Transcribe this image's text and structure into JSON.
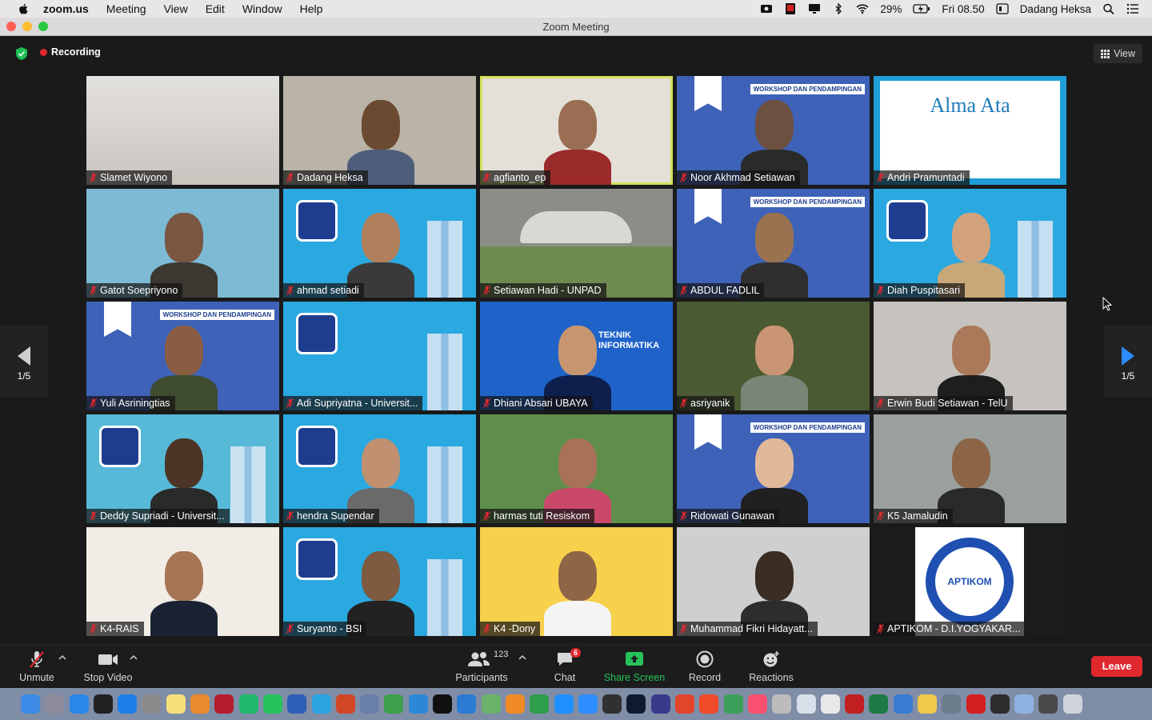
{
  "menubar": {
    "app": "zoom.us",
    "items": [
      "Meeting",
      "View",
      "Edit",
      "Window",
      "Help"
    ],
    "battery": "29%",
    "clock": "Fri 08.50",
    "user": "Dadang Heksa"
  },
  "window": {
    "title": "Zoom Meeting"
  },
  "meeting": {
    "recording_label": "Recording",
    "view_label": "View",
    "page_indicator": "1/5"
  },
  "participants": [
    {
      "name": "Slamet Wiyono",
      "bg": "#d9d6d2",
      "skin": "",
      "shirt": "",
      "active": false
    },
    {
      "name": "Dadang Heksa",
      "bg": "#b9b3a8",
      "skin": "#6b4a32",
      "shirt": "#4e5d7a",
      "active": false
    },
    {
      "name": "agfianto_ep",
      "bg": "#e4e0d8",
      "skin": "#9a6e53",
      "shirt": "#9b2a2a",
      "active": true
    },
    {
      "name": "Noor Akhmad Setiawan",
      "bg": "#3e62b8",
      "skin": "#6d5040",
      "shirt": "#2a2a2a",
      "active": false
    },
    {
      "name": "Andri Pramuntadi",
      "bg": "#1f9ed8",
      "skin": "",
      "shirt": "",
      "active": false
    },
    {
      "name": "Gatot Soepriyono",
      "bg": "#7dbad3",
      "skin": "#7a5641",
      "shirt": "#3a3830",
      "active": false
    },
    {
      "name": "ahmad setiadi",
      "bg": "#2aa8e0",
      "skin": "#b07f5c",
      "shirt": "#3a3a3a",
      "active": false
    },
    {
      "name": "Setiawan Hadi - UNPAD",
      "bg": "#8a8e86",
      "skin": "",
      "shirt": "",
      "active": false
    },
    {
      "name": "ABDUL FADLIL",
      "bg": "#3e62b8",
      "skin": "#9a7250",
      "shirt": "#2f2f2f",
      "active": false
    },
    {
      "name": "Diah Puspitasari",
      "bg": "#2aa8e0",
      "skin": "#d2a27c",
      "shirt": "#c8a878",
      "active": false
    },
    {
      "name": "Yuli Asriningtias",
      "bg": "#3e62b8",
      "skin": "#8a5d42",
      "shirt": "#3f4c2f",
      "active": false
    },
    {
      "name": "Adi Supriyatna - Universit...",
      "bg": "#2aa8e0",
      "skin": "",
      "shirt": "",
      "active": false
    },
    {
      "name": "Dhiani Absari UBAYA",
      "bg": "#1f63c9",
      "skin": "#c79671",
      "shirt": "#0d1f4d",
      "active": false
    },
    {
      "name": "asriyanik",
      "bg": "#4a5a32",
      "skin": "#c99574",
      "shirt": "#7a8578",
      "active": false
    },
    {
      "name": "Erwin Budi Setiawan - TelU",
      "bg": "#c6c3be",
      "skin": "#a9795a",
      "shirt": "#1e1e1e",
      "active": false
    },
    {
      "name": "Deddy Supriadi - Universit...",
      "bg": "#57b9d8",
      "skin": "#4d3526",
      "shirt": "#2a2a2a",
      "active": false
    },
    {
      "name": "hendra Supendar",
      "bg": "#2aa8e0",
      "skin": "#c09070",
      "shirt": "#6a6a6a",
      "active": false
    },
    {
      "name": "harmas tuti Resiskom",
      "bg": "#5f8e4a",
      "skin": "#a87258",
      "shirt": "#c9486a",
      "active": false
    },
    {
      "name": "Ridowati Gunawan",
      "bg": "#3e62b8",
      "skin": "#e0b89a",
      "shirt": "#202020",
      "active": false
    },
    {
      "name": "K5 Jamaludin",
      "bg": "#9aa09e",
      "skin": "#8b6546",
      "shirt": "#2a2a2a",
      "active": false
    },
    {
      "name": "K4-RAIS",
      "bg": "#f1ede6",
      "skin": "#a57556",
      "shirt": "#1a2233",
      "active": false
    },
    {
      "name": "Suryanto - BSI",
      "bg": "#2aa8e0",
      "skin": "#7d5a40",
      "shirt": "#222222",
      "active": false
    },
    {
      "name": "K4 -Dony",
      "bg": "#f7d04c",
      "skin": "#8e6546",
      "shirt": "#f4f4f4",
      "active": false
    },
    {
      "name": "Muhammad Fikri Hidayatt...",
      "bg": "#cfcfcf",
      "skin": "#3a2d24",
      "shirt": "#2d2d2d",
      "active": false
    },
    {
      "name": "APTIKOM - D.I.YOGYAKAR...",
      "bg": "#1c1c1c",
      "skin": "",
      "shirt": "",
      "active": false
    }
  ],
  "tile_text": {
    "alma_ata": "Alma Ata",
    "teknik": "TEKNIK INFORMATIKA",
    "workshop": "WORKSHOP DAN PENDAMPINGAN",
    "aptikom": "APTIKOM"
  },
  "toolbar": {
    "unmute": "Unmute",
    "stop_video": "Stop Video",
    "participants": "Participants",
    "participant_count": "123",
    "chat": "Chat",
    "chat_badge": "6",
    "share_screen": "Share Screen",
    "record": "Record",
    "reactions": "Reactions",
    "leave": "Leave"
  },
  "dock": {
    "icons": [
      "finder-icon",
      "launchpad-icon",
      "safari-icon",
      "terminal-icon",
      "app-store-icon",
      "system-preferences-icon",
      "notes-icon",
      "books-icon",
      "mendeley-icon",
      "grammarly-icon",
      "whatsapp-icon",
      "word-icon",
      "telegram-icon",
      "powerpoint-icon",
      "virtualbox-icon",
      "anaconda-icon",
      "ms-edge-icon",
      "intellij-icon",
      "vscode-icon",
      "android-file-icon",
      "sublime-icon",
      "mongodb-icon",
      "camo-icon",
      "zoom-icon",
      "obs-icon",
      "photoshop-icon",
      "davinci-icon",
      "git-icon",
      "brave-icon",
      "android-studio-icon",
      "music-icon",
      "database-icon",
      "preview-icon",
      "chrome-icon",
      "filezilla-icon",
      "excel-icon",
      "network-icon",
      "photos-icon",
      "screenshot-icon",
      "acrobat-icon",
      "quicktime-icon",
      "folder-icon",
      "monitor-icon",
      "trash-icon"
    ],
    "colors": [
      "#3c8be6",
      "#8c8c9c",
      "#2a86e8",
      "#222222",
      "#1e7ee8",
      "#8a8a8a",
      "#f5e07a",
      "#e88a2e",
      "#b41e2c",
      "#20b86a",
      "#25c35a",
      "#2b5fb6",
      "#2ba4e0",
      "#d24726",
      "#6a7fa8",
      "#3ca04a",
      "#2b88d8",
      "#111111",
      "#2a7bd4",
      "#6ab46a",
      "#f08a24",
      "#2e9e4a",
      "#1e90ff",
      "#2d8cff",
      "#303030",
      "#0e1a2e",
      "#3a3a8a",
      "#e2442c",
      "#f04a2a",
      "#3ca05a",
      "#fa5070",
      "#bcbcbc",
      "#d8e0ea",
      "#e8e8e8",
      "#c22020",
      "#1d7a45",
      "#3a7ad4",
      "#f2c84c",
      "#6c7c8c",
      "#d42020",
      "#2c2c2c",
      "#8fb3e0",
      "#4a4a4a",
      "#cfd4da"
    ]
  }
}
